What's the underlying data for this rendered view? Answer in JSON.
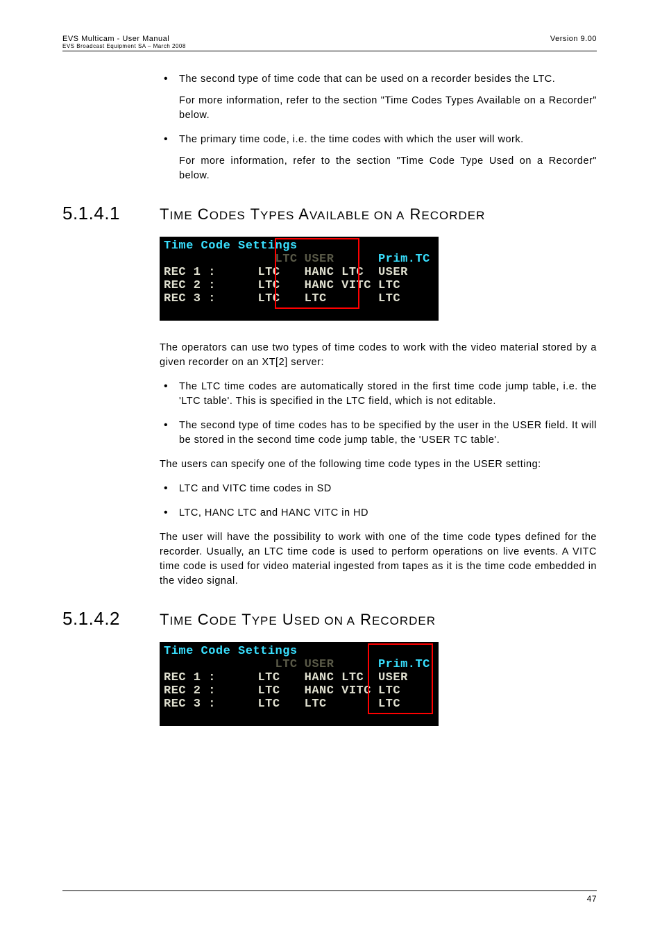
{
  "header": {
    "left_line1": "EVS Multicam - User Manual",
    "left_line2": "EVS Broadcast Equipment SA – March 2008",
    "right": "Version 9.00"
  },
  "intro": {
    "bullets": [
      {
        "main": "The second type of time code that can be used on a recorder besides the LTC.",
        "sub": "For more information, refer to the section \"Time Codes Types Available on a Recorder\" below."
      },
      {
        "main": "The primary time code, i.e. the time codes with which the user will work.",
        "sub": "For more information, refer to the section \"Time Code Type Used on a Recorder\" below."
      }
    ]
  },
  "section1": {
    "num": "5.1.4.1",
    "title": "Time Codes Types Available on a Recorder",
    "figure": {
      "title": "Time Code Settings",
      "col_ltc": "LTC",
      "col_user": "USER",
      "col_prim": "Prim.TC",
      "rows": [
        {
          "name": "REC 1 :",
          "ltc": "LTC",
          "user": "HANC LTC",
          "prim": "USER"
        },
        {
          "name": "REC 2 :",
          "ltc": "LTC",
          "user": "HANC VITC",
          "prim": "LTC"
        },
        {
          "name": "REC 3 :",
          "ltc": "LTC",
          "user": "LTC",
          "prim": "LTC"
        }
      ]
    },
    "para1": "The operators can use two types of time codes to work with the video material stored by a given recorder on an XT[2] server:",
    "bullets1": [
      "The LTC time codes are automatically stored in the first time code jump table, i.e. the 'LTC table'. This is specified in the LTC field, which is not editable.",
      "The second type of time codes has to be specified by the user in the USER field. It will be stored in the second time code jump table, the 'USER TC table'."
    ],
    "para2": "The users can specify one of the following time code types in the USER setting:",
    "bullets2": [
      "LTC and VITC time codes in SD",
      "LTC, HANC LTC and HANC VITC in HD"
    ],
    "para3": "The user will have the possibility to work with one of the time code types defined for the recorder. Usually, an LTC time code is used to perform operations on live events. A VITC time code is used for video material ingested from tapes as it is the time code embedded in the video signal."
  },
  "section2": {
    "num": "5.1.4.2",
    "title": "Time Code Type Used on a Recorder",
    "figure": {
      "title": "Time Code Settings",
      "col_ltc": "LTC",
      "col_user": "USER",
      "col_prim": "Prim.TC",
      "rows": [
        {
          "name": "REC 1 :",
          "ltc": "LTC",
          "user": "HANC LTC",
          "prim": "USER"
        },
        {
          "name": "REC 2 :",
          "ltc": "LTC",
          "user": "HANC VITC",
          "prim": "LTC"
        },
        {
          "name": "REC 3 :",
          "ltc": "LTC",
          "user": "LTC",
          "prim": "LTC"
        }
      ]
    }
  },
  "footer": {
    "page": "47"
  }
}
